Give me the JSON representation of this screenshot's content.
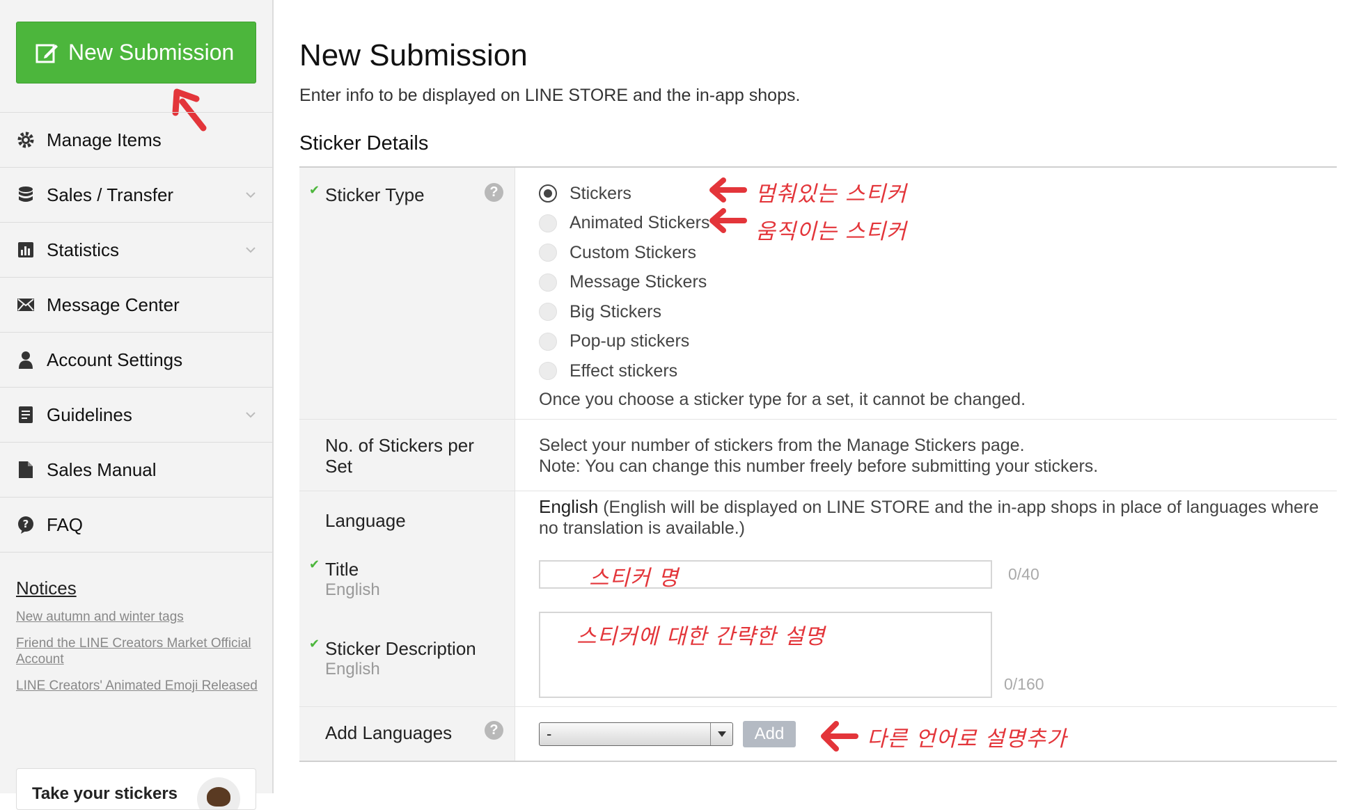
{
  "sidebar": {
    "new_button": "New Submission",
    "items": [
      {
        "label": "Manage Items",
        "icon": "gear-icon",
        "chevron": false
      },
      {
        "label": "Sales / Transfer",
        "icon": "database-icon",
        "chevron": true
      },
      {
        "label": "Statistics",
        "icon": "bar-chart-icon",
        "chevron": true
      },
      {
        "label": "Message Center",
        "icon": "envelope-icon",
        "chevron": false
      },
      {
        "label": "Account Settings",
        "icon": "user-icon",
        "chevron": false
      },
      {
        "label": "Guidelines",
        "icon": "document-icon",
        "chevron": true
      },
      {
        "label": "Sales Manual",
        "icon": "file-icon",
        "chevron": false
      },
      {
        "label": "FAQ",
        "icon": "question-bubble-icon",
        "chevron": false
      }
    ],
    "notices_title": "Notices",
    "notices": [
      "New autumn and winter tags",
      "Friend the LINE Creators Market Official Account",
      "LINE Creators' Animated Emoji Released"
    ],
    "promo_text": "Take your stickers"
  },
  "main": {
    "title": "New Submission",
    "subtitle": "Enter info to be displayed on LINE STORE and the in-app shops.",
    "section_title": "Sticker Details",
    "sticker_type": {
      "label": "Sticker Type",
      "options": [
        "Stickers",
        "Animated Stickers",
        "Custom Stickers",
        "Message Stickers",
        "Big Stickers",
        "Pop-up stickers",
        "Effect stickers"
      ],
      "selected": "Stickers",
      "note": "Once you choose a sticker type for a set, it cannot be changed."
    },
    "num_stickers": {
      "label": "No. of Stickers per Set",
      "line1": "Select your number of stickers from the Manage Stickers page.",
      "line2": "Note: You can change this number freely before submitting your stickers."
    },
    "language": {
      "label": "Language",
      "value_bold": "English",
      "value_note": " (English will be displayed on LINE STORE and the in-app shops in place of languages where no translation is available.)"
    },
    "title_field": {
      "label": "Title",
      "sub": "English",
      "value": "",
      "counter": "0/40"
    },
    "description_field": {
      "label": "Sticker Description",
      "sub": "English",
      "value": "",
      "counter": "0/160"
    },
    "add_languages": {
      "label": "Add Languages",
      "select_value": "-",
      "button": "Add"
    }
  },
  "annotations": {
    "static_stickers": "멈춰있는 스티커",
    "animated_stickers": "움직이는 스티커",
    "title_hint": "스티커 명",
    "description_hint": "스티커에 대한 간략한 설명",
    "add_lang_hint": "다른 언어로 설명추가"
  },
  "colors": {
    "accent_green": "#4cb63c",
    "annotation_red": "#e3353a",
    "add_button": "#b4bac3"
  }
}
